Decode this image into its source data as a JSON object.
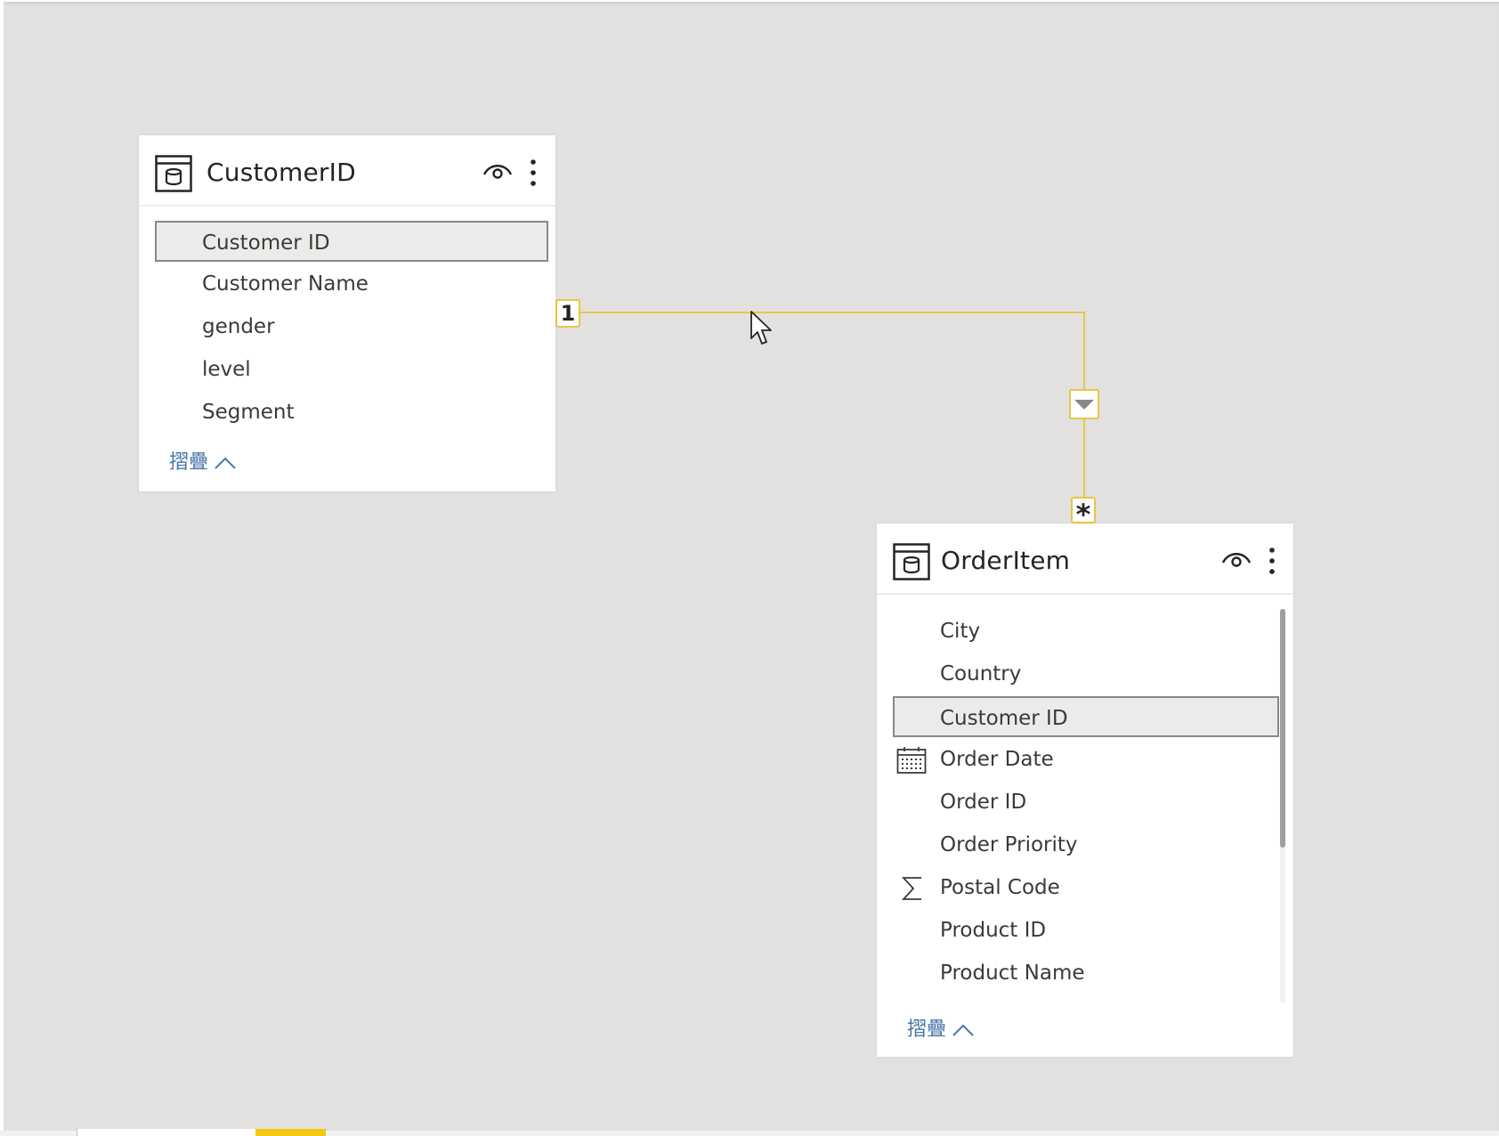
{
  "tables": [
    {
      "title": "CustomerID",
      "fields": [
        {
          "label": "Customer ID",
          "selected": true,
          "icon": ""
        },
        {
          "label": "Customer Name",
          "selected": false,
          "icon": ""
        },
        {
          "label": "gender",
          "selected": false,
          "icon": ""
        },
        {
          "label": "level",
          "selected": false,
          "icon": ""
        },
        {
          "label": "Segment",
          "selected": false,
          "icon": ""
        }
      ],
      "collapse_label": "摺疊"
    },
    {
      "title": "OrderItem",
      "fields": [
        {
          "label": "City",
          "selected": false,
          "icon": ""
        },
        {
          "label": "Country",
          "selected": false,
          "icon": ""
        },
        {
          "label": "Customer ID",
          "selected": true,
          "icon": ""
        },
        {
          "label": "Order Date",
          "selected": false,
          "icon": "calendar-icon"
        },
        {
          "label": "Order ID",
          "selected": false,
          "icon": ""
        },
        {
          "label": "Order Priority",
          "selected": false,
          "icon": ""
        },
        {
          "label": "Postal Code",
          "selected": false,
          "icon": "sigma-icon"
        },
        {
          "label": "Product ID",
          "selected": false,
          "icon": ""
        },
        {
          "label": "Product Name",
          "selected": false,
          "icon": ""
        }
      ],
      "collapse_label": "摺疊"
    }
  ],
  "relationship": {
    "from_cardinality": "1",
    "to_cardinality": "*",
    "filter_direction": "single",
    "line_color": "#e8c547"
  },
  "colors": {
    "canvas": "#e2e1e0",
    "selected_field": "#edebe9",
    "collapse_link": "#4a76a8",
    "page_tab_accent": "#f2c811"
  }
}
